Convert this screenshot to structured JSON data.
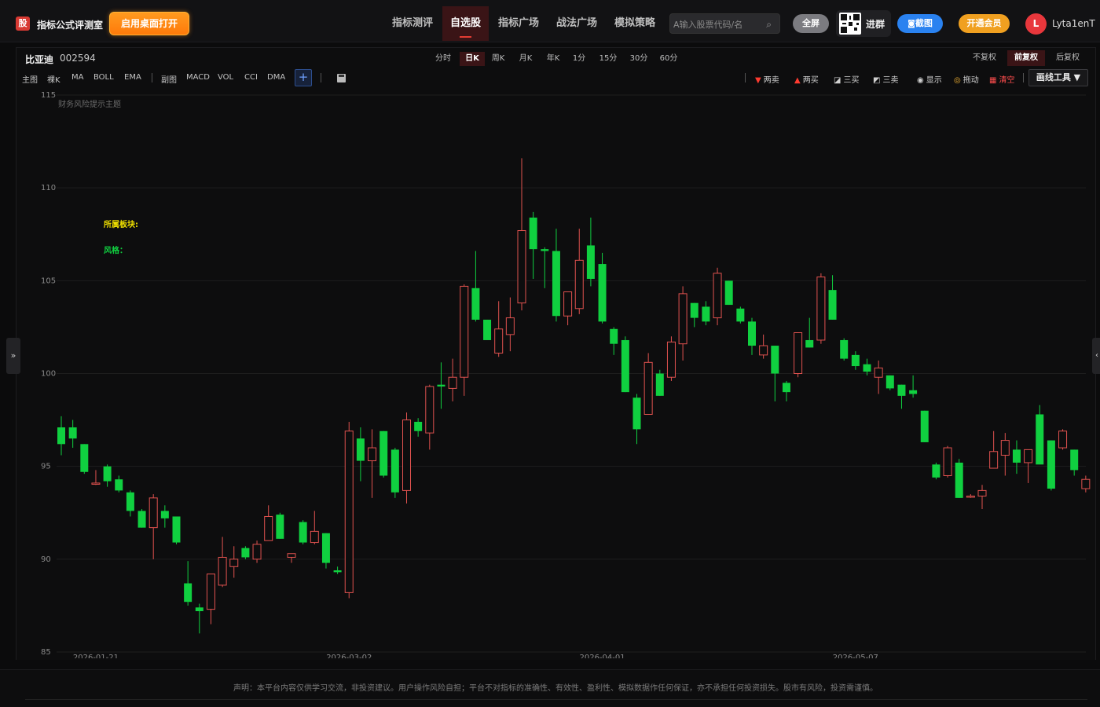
{
  "header": {
    "logo_char": "股",
    "brand": "指标公式评测室",
    "desktop_button": "启用桌面打开",
    "nav": [
      "指标测评",
      "自选股",
      "指标广场",
      "战法广场",
      "模拟策略"
    ],
    "nav_active": 1,
    "search_placeholder": "A输入股票代码/名",
    "fullscreen": "全屏",
    "join_group": "进群",
    "screenshot": "截图",
    "membership": "开通会员",
    "avatar_letter": "L",
    "username": "Lyta1enT"
  },
  "stock": {
    "name": "比亚迪",
    "code": "002594"
  },
  "periods": [
    "分时",
    "日K",
    "周K",
    "月K",
    "年K",
    "1分",
    "15分",
    "30分",
    "60分"
  ],
  "period_active": 1,
  "adjust": [
    "不复权",
    "前复权",
    "后复权"
  ],
  "adjust_active": 1,
  "indicators_main": [
    "主图",
    "裸K",
    "MA",
    "BOLL",
    "EMA"
  ],
  "indicators_sub": [
    "副图",
    "MACD",
    "VOL",
    "CCI",
    "DMA"
  ],
  "add_symbol": "+",
  "tools": [
    {
      "icon": "▼",
      "label": "两卖",
      "color": "#ff3b30"
    },
    {
      "icon": "▲",
      "label": "两买",
      "color": "#ff3b30"
    },
    {
      "icon": "◪",
      "label": "三买",
      "color": "#d0d0d0"
    },
    {
      "icon": "◩",
      "label": "三卖",
      "color": "#d0d0d0"
    },
    {
      "icon": "◉",
      "label": "显示",
      "color": "#d0d0d0"
    },
    {
      "icon": "◎",
      "label": "拖动",
      "color": "#f2b233"
    },
    {
      "icon": "▦",
      "label": "清空",
      "color": "#ff4d4d"
    }
  ],
  "draw_tools": "画线工具 ▼",
  "side_left": "»",
  "side_right": "‹",
  "chart_labels": {
    "risk_note": "财务风险提示主题",
    "sector": "所属板块:",
    "style": "风格："
  },
  "colors": {
    "up": "#e0524f",
    "down": "#10d040",
    "grid": "#1e1e1e",
    "accent_red": "#e23c33"
  },
  "footer": {
    "disclaimer": "声明：本平台内容仅供学习交流，非投资建议。用户操作风险自担；平台不对指标的准确性、有效性、盈利性、模拟数据作任何保证，亦不承担任何投资损失。股市有风险，投资需谨慎。"
  },
  "chart_data": {
    "type": "candlestick",
    "ylim": [
      85,
      115
    ],
    "y_ticks": [
      85,
      90,
      95,
      100,
      105,
      110,
      115
    ],
    "x_ticks": [
      {
        "index": 3,
        "label": "2026-01-21"
      },
      {
        "index": 25,
        "label": "2026-03-02"
      },
      {
        "index": 47,
        "label": "2026-04-01"
      },
      {
        "index": 69,
        "label": "2026-05-07"
      }
    ],
    "candles": [
      {
        "o": 97.1,
        "h": 97.7,
        "l": 95.6,
        "c": 96.2
      },
      {
        "o": 97.1,
        "h": 97.5,
        "l": 96.0,
        "c": 96.5
      },
      {
        "o": 96.2,
        "h": 96.2,
        "l": 94.6,
        "c": 94.7
      },
      {
        "o": 94.1,
        "h": 94.8,
        "l": 94.0,
        "c": 94.1
      },
      {
        "o": 95.0,
        "h": 95.1,
        "l": 93.9,
        "c": 94.2
      },
      {
        "o": 94.3,
        "h": 94.5,
        "l": 93.6,
        "c": 93.7
      },
      {
        "o": 93.6,
        "h": 93.7,
        "l": 92.3,
        "c": 92.6
      },
      {
        "o": 92.6,
        "h": 92.7,
        "l": 91.7,
        "c": 91.7
      },
      {
        "o": 91.7,
        "h": 93.5,
        "l": 90.0,
        "c": 93.3
      },
      {
        "o": 92.6,
        "h": 92.9,
        "l": 91.7,
        "c": 92.2
      },
      {
        "o": 92.3,
        "h": 92.3,
        "l": 90.8,
        "c": 90.9
      },
      {
        "o": 88.7,
        "h": 89.9,
        "l": 87.5,
        "c": 87.7
      },
      {
        "o": 87.4,
        "h": 87.6,
        "l": 86.0,
        "c": 87.2
      },
      {
        "o": 87.3,
        "h": 89.2,
        "l": 86.5,
        "c": 89.2
      },
      {
        "o": 88.6,
        "h": 91.2,
        "l": 88.5,
        "c": 90.1
      },
      {
        "o": 89.6,
        "h": 90.7,
        "l": 89.0,
        "c": 90.0
      },
      {
        "o": 90.6,
        "h": 90.7,
        "l": 90.0,
        "c": 90.1
      },
      {
        "o": 90.0,
        "h": 91.0,
        "l": 89.8,
        "c": 90.8
      },
      {
        "o": 91.0,
        "h": 92.9,
        "l": 91.0,
        "c": 92.3
      },
      {
        "o": 92.4,
        "h": 92.5,
        "l": 91.1,
        "c": 91.1
      },
      {
        "o": 90.1,
        "h": 90.3,
        "l": 89.8,
        "c": 90.3
      },
      {
        "o": 92.0,
        "h": 92.1,
        "l": 90.8,
        "c": 90.9
      },
      {
        "o": 90.9,
        "h": 92.6,
        "l": 90.8,
        "c": 91.5
      },
      {
        "o": 91.4,
        "h": 91.4,
        "l": 89.5,
        "c": 89.8
      },
      {
        "o": 89.4,
        "h": 89.6,
        "l": 89.2,
        "c": 89.3
      },
      {
        "o": 88.2,
        "h": 97.4,
        "l": 87.9,
        "c": 96.9
      },
      {
        "o": 96.5,
        "h": 97.1,
        "l": 94.2,
        "c": 95.3
      },
      {
        "o": 95.3,
        "h": 97.0,
        "l": 93.3,
        "c": 96.0
      },
      {
        "o": 96.9,
        "h": 96.9,
        "l": 94.4,
        "c": 94.5
      },
      {
        "o": 95.9,
        "h": 96.0,
        "l": 93.3,
        "c": 93.6
      },
      {
        "o": 93.7,
        "h": 97.9,
        "l": 93.0,
        "c": 97.5
      },
      {
        "o": 97.4,
        "h": 97.6,
        "l": 96.6,
        "c": 96.9
      },
      {
        "o": 96.8,
        "h": 99.4,
        "l": 95.9,
        "c": 99.3
      },
      {
        "o": 99.4,
        "h": 100.6,
        "l": 98.1,
        "c": 99.3
      },
      {
        "o": 99.2,
        "h": 100.8,
        "l": 98.5,
        "c": 99.8
      },
      {
        "o": 99.8,
        "h": 104.8,
        "l": 98.8,
        "c": 104.7
      },
      {
        "o": 104.6,
        "h": 106.6,
        "l": 102.8,
        "c": 102.9
      },
      {
        "o": 102.9,
        "h": 102.9,
        "l": 101.8,
        "c": 101.8
      },
      {
        "o": 101.1,
        "h": 103.9,
        "l": 100.9,
        "c": 102.4
      },
      {
        "o": 102.1,
        "h": 104.1,
        "l": 101.2,
        "c": 103.0
      },
      {
        "o": 103.8,
        "h": 111.6,
        "l": 103.4,
        "c": 107.7
      },
      {
        "o": 108.4,
        "h": 108.7,
        "l": 105.1,
        "c": 106.7
      },
      {
        "o": 106.7,
        "h": 106.8,
        "l": 104.6,
        "c": 106.6
      },
      {
        "o": 106.6,
        "h": 107.8,
        "l": 102.8,
        "c": 103.1
      },
      {
        "o": 103.1,
        "h": 104.3,
        "l": 102.6,
        "c": 104.4
      },
      {
        "o": 103.5,
        "h": 107.8,
        "l": 103.2,
        "c": 106.1
      },
      {
        "o": 106.9,
        "h": 108.4,
        "l": 104.7,
        "c": 105.1
      },
      {
        "o": 105.9,
        "h": 106.5,
        "l": 102.7,
        "c": 102.8
      },
      {
        "o": 102.4,
        "h": 102.5,
        "l": 101.0,
        "c": 101.6
      },
      {
        "o": 101.8,
        "h": 102.0,
        "l": 99.0,
        "c": 99.0
      },
      {
        "o": 98.7,
        "h": 98.9,
        "l": 96.2,
        "c": 97.0
      },
      {
        "o": 97.8,
        "h": 101.1,
        "l": 97.8,
        "c": 100.6
      },
      {
        "o": 100.0,
        "h": 100.2,
        "l": 98.8,
        "c": 98.8
      },
      {
        "o": 99.8,
        "h": 102.0,
        "l": 99.6,
        "c": 101.7
      },
      {
        "o": 101.6,
        "h": 104.7,
        "l": 100.7,
        "c": 104.3
      },
      {
        "o": 103.8,
        "h": 103.8,
        "l": 102.5,
        "c": 103.0
      },
      {
        "o": 103.6,
        "h": 103.9,
        "l": 102.6,
        "c": 102.8
      },
      {
        "o": 103.0,
        "h": 105.7,
        "l": 102.6,
        "c": 105.4
      },
      {
        "o": 105.0,
        "h": 105.0,
        "l": 103.7,
        "c": 103.7
      },
      {
        "o": 103.5,
        "h": 103.6,
        "l": 102.7,
        "c": 102.8
      },
      {
        "o": 102.8,
        "h": 103.0,
        "l": 101.0,
        "c": 101.5
      },
      {
        "o": 101.0,
        "h": 102.1,
        "l": 100.8,
        "c": 101.5
      },
      {
        "o": 101.5,
        "h": 101.5,
        "l": 98.5,
        "c": 100.0
      },
      {
        "o": 99.5,
        "h": 99.6,
        "l": 98.5,
        "c": 99.0
      },
      {
        "o": 100.0,
        "h": 102.2,
        "l": 99.8,
        "c": 102.2
      },
      {
        "o": 101.8,
        "h": 103.0,
        "l": 101.4,
        "c": 101.4
      },
      {
        "o": 101.8,
        "h": 105.4,
        "l": 101.6,
        "c": 105.2
      },
      {
        "o": 104.5,
        "h": 105.3,
        "l": 102.9,
        "c": 102.9
      },
      {
        "o": 101.8,
        "h": 101.9,
        "l": 100.7,
        "c": 100.8
      },
      {
        "o": 101.0,
        "h": 101.2,
        "l": 100.2,
        "c": 100.4
      },
      {
        "o": 100.5,
        "h": 100.8,
        "l": 99.9,
        "c": 100.1
      },
      {
        "o": 99.8,
        "h": 100.7,
        "l": 98.9,
        "c": 100.3
      },
      {
        "o": 99.9,
        "h": 99.9,
        "l": 99.1,
        "c": 99.2
      },
      {
        "o": 99.4,
        "h": 99.4,
        "l": 98.1,
        "c": 98.8
      },
      {
        "o": 99.1,
        "h": 99.9,
        "l": 98.7,
        "c": 98.9
      },
      {
        "o": 98.0,
        "h": 98.0,
        "l": 96.3,
        "c": 96.3
      },
      {
        "o": 95.1,
        "h": 95.2,
        "l": 94.3,
        "c": 94.4
      },
      {
        "o": 94.5,
        "h": 96.1,
        "l": 94.4,
        "c": 96.0
      },
      {
        "o": 95.2,
        "h": 95.4,
        "l": 93.3,
        "c": 93.3
      },
      {
        "o": 93.4,
        "h": 93.5,
        "l": 93.3,
        "c": 93.4
      },
      {
        "o": 93.4,
        "h": 94.0,
        "l": 92.7,
        "c": 93.7
      },
      {
        "o": 94.9,
        "h": 96.9,
        "l": 94.9,
        "c": 95.8
      },
      {
        "o": 95.6,
        "h": 96.8,
        "l": 94.5,
        "c": 96.4
      },
      {
        "o": 95.9,
        "h": 96.4,
        "l": 94.6,
        "c": 95.2
      },
      {
        "o": 95.2,
        "h": 95.9,
        "l": 94.1,
        "c": 95.9
      },
      {
        "o": 97.8,
        "h": 98.3,
        "l": 95.2,
        "c": 95.1
      },
      {
        "o": 96.4,
        "h": 96.4,
        "l": 93.7,
        "c": 93.8
      },
      {
        "o": 96.0,
        "h": 97.0,
        "l": 95.9,
        "c": 96.9
      },
      {
        "o": 95.9,
        "h": 95.9,
        "l": 94.5,
        "c": 94.8
      },
      {
        "o": 93.8,
        "h": 94.5,
        "l": 93.6,
        "c": 94.3
      }
    ]
  }
}
